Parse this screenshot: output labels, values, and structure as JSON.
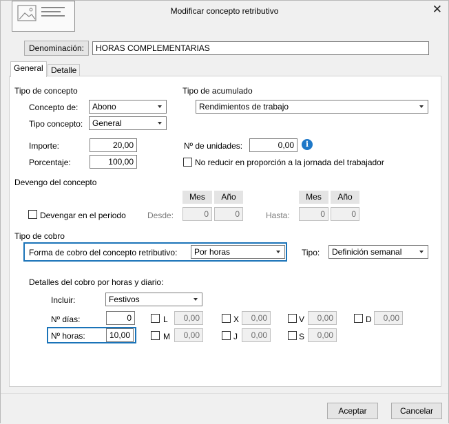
{
  "window": {
    "title": "Modificar concepto retributivo",
    "close_icon": "close-icon",
    "logo_icon": "document-logo-icon"
  },
  "denominacion": {
    "button_label": "Denominación:",
    "value": "HORAS COMPLEMENTARIAS"
  },
  "tabs": [
    {
      "label": "General"
    },
    {
      "label": "Detalle"
    }
  ],
  "tipo_concepto": {
    "heading": "Tipo de concepto",
    "concepto_de_label": "Concepto de:",
    "concepto_de_value": "Abono",
    "tipo_concepto_label": "Tipo concepto:",
    "tipo_concepto_value": "General",
    "importe_label": "Importe:",
    "importe_value": "20,00",
    "porcentaje_label": "Porcentaje:",
    "porcentaje_value": "100,00"
  },
  "tipo_acumulado": {
    "heading": "Tipo de acumulado",
    "value": "Rendimientos de trabajo",
    "unidades_label": "Nº de unidades:",
    "unidades_value": "0,00",
    "info_icon": "info-icon",
    "no_reducir_label": "No reducir en proporción a la jornada del trabajador",
    "no_reducir_checked": false
  },
  "devengo": {
    "heading": "Devengo del concepto",
    "devengar_label": "Devengar en el periodo",
    "devengar_checked": false,
    "mes_label": "Mes",
    "anio_label": "Año",
    "desde_label": "Desde:",
    "desde_mes": "0",
    "desde_anio": "0",
    "hasta_label": "Hasta:",
    "hasta_mes": "0",
    "hasta_anio": "0"
  },
  "tipo_cobro": {
    "heading": "Tipo de cobro",
    "forma_label": "Forma de cobro del concepto retributivo:",
    "forma_value": "Por horas",
    "tipo_label": "Tipo:",
    "tipo_value": "Definición semanal"
  },
  "detalles": {
    "heading": "Detalles del cobro por horas y diario:",
    "incluir_label": "Incluir:",
    "incluir_value": "Festivos",
    "num_dias_label": "Nº días:",
    "num_dias_value": "0",
    "num_horas_label": "Nº horas:",
    "num_horas_value": "10,00",
    "days": [
      {
        "letter": "L",
        "value": "0,00",
        "checked": false
      },
      {
        "letter": "X",
        "value": "0,00",
        "checked": false
      },
      {
        "letter": "V",
        "value": "0,00",
        "checked": false
      },
      {
        "letter": "D",
        "value": "0,00",
        "checked": false
      },
      {
        "letter": "M",
        "value": "0,00",
        "checked": false
      },
      {
        "letter": "J",
        "value": "0,00",
        "checked": false
      },
      {
        "letter": "S",
        "value": "0,00",
        "checked": false
      }
    ]
  },
  "footer": {
    "aceptar_label": "Aceptar",
    "cancelar_label": "Cancelar"
  },
  "colors": {
    "focus_blue": "#1a73b8",
    "info_blue": "#1e78c8"
  }
}
